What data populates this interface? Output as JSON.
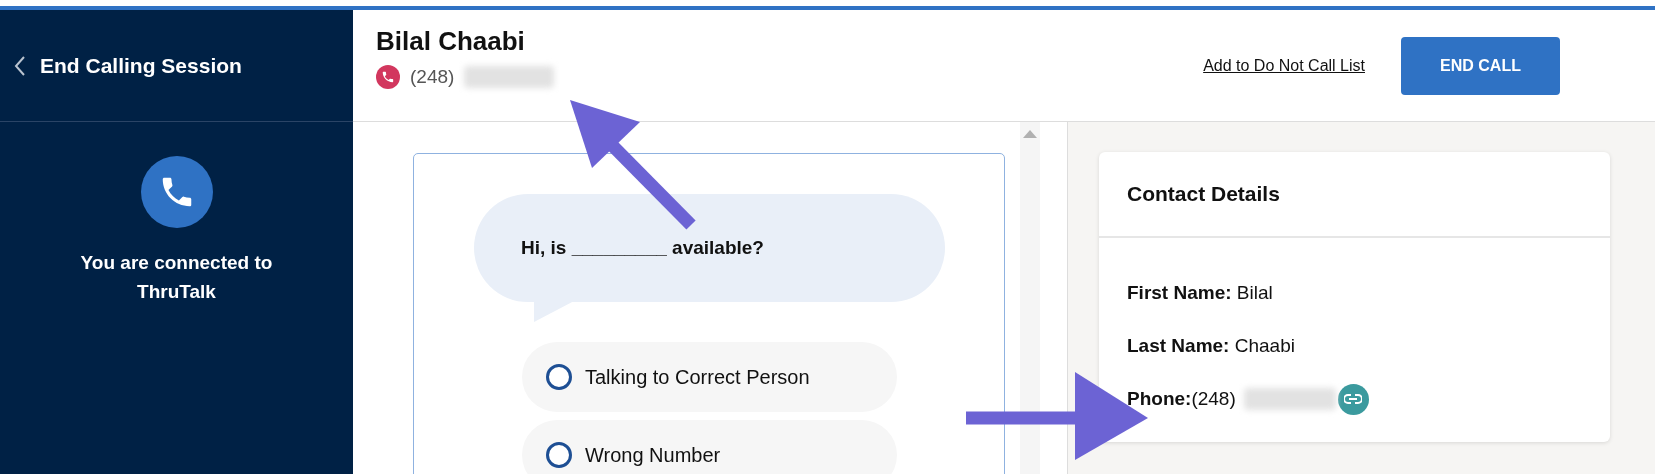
{
  "sidebar": {
    "back_label": "End Calling Session",
    "status": "You are connected to ThruTalk"
  },
  "header": {
    "name": "Bilal Chaabi",
    "phone_prefix": "(248)",
    "link": "Add to Do Not Call List",
    "button": "END CALL"
  },
  "script": {
    "question": "Hi, is _________ available?",
    "options": [
      {
        "label": "Talking to Correct Person",
        "selected": false
      },
      {
        "label": "Wrong Number",
        "selected": false
      }
    ]
  },
  "contact": {
    "title": "Contact Details",
    "fields": [
      {
        "kind": "text",
        "label": "First Name:",
        "value": "Bilal"
      },
      {
        "kind": "text",
        "label": "Last Name:",
        "value": "Chaabi"
      },
      {
        "kind": "phone",
        "label": "Phone:",
        "value": "(248)"
      }
    ]
  }
}
